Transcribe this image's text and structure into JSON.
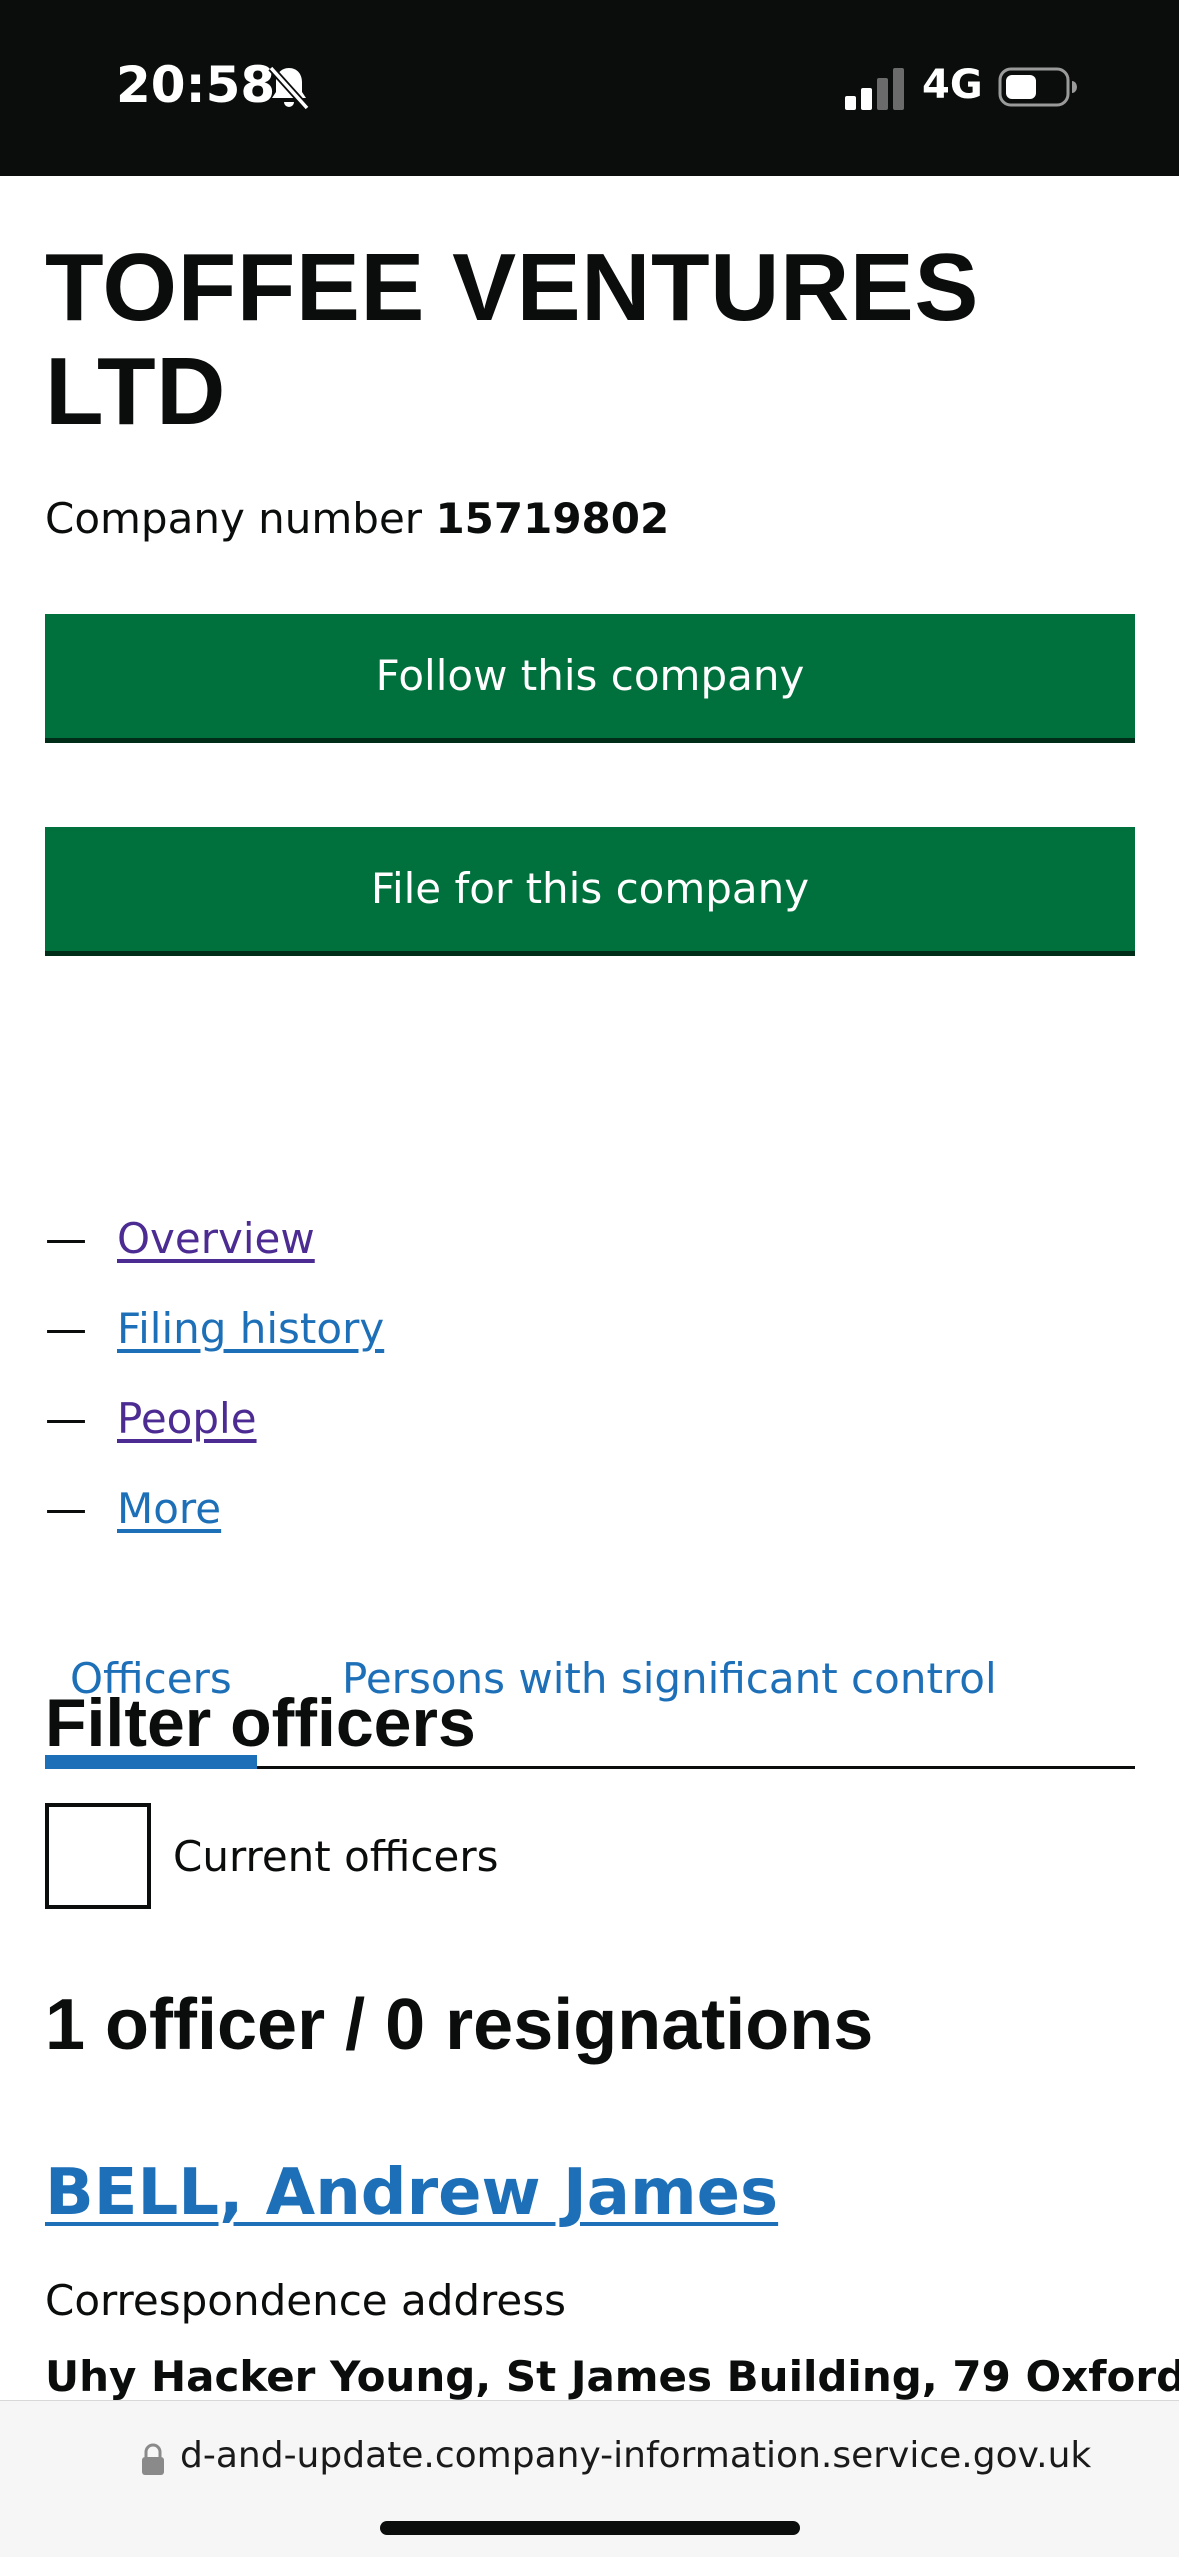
{
  "status_bar": {
    "time": "20:58",
    "network": "4G",
    "icons": [
      "bell-slash-icon",
      "cellular-signal-icon",
      "battery-icon"
    ]
  },
  "company": {
    "name": "TOFFEE VENTURES LTD",
    "number_label": "Company number",
    "number": "15719802"
  },
  "buttons": {
    "follow": "Follow this company",
    "file": "File for this company"
  },
  "subnav": [
    {
      "label": "Overview"
    },
    {
      "label": "Filing history"
    },
    {
      "label": "People"
    },
    {
      "label": "More"
    }
  ],
  "tabs": [
    {
      "label": "Officers",
      "selected": true
    },
    {
      "label": "Persons with significant control",
      "selected": false
    }
  ],
  "filter": {
    "heading": "Filter officers",
    "checkbox_label": "Current officers",
    "checked": false
  },
  "officers": {
    "count_heading": "1 officer / 0 resignations",
    "items": [
      {
        "name": "BELL, Andrew James",
        "address_label": "Correspondence address",
        "address": "Uhy Hacker Young, St James Building, 79 Oxford"
      }
    ]
  },
  "browser": {
    "url": "d-and-update.company-information.service.gov.uk"
  },
  "colors": {
    "gov_green": "#00703c",
    "link_blue": "#1d70b8",
    "visited_purple": "#4c2c92",
    "text": "#0b0c0c"
  }
}
